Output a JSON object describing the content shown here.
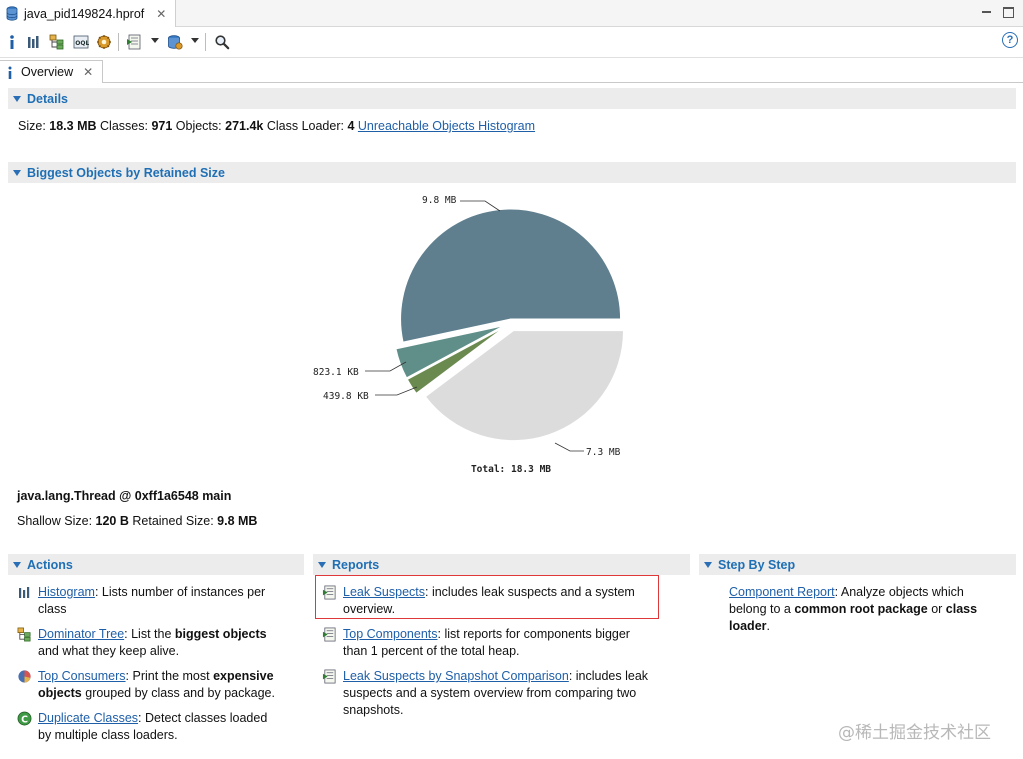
{
  "editor_tab": {
    "label": "java_pid149824.hprof"
  },
  "toolbar": {
    "items": [
      "info-icon",
      "histogram-icon",
      "dominator-tree-icon",
      "oql-icon",
      "top-consumers-icon",
      "run-report-icon",
      "heap-dump-overview-icon",
      "search-icon"
    ],
    "help": "?"
  },
  "view_tab": {
    "label": "Overview"
  },
  "details": {
    "header": "Details",
    "size_label": "Size:",
    "size_value": "18.3 MB",
    "classes_label": "Classes:",
    "classes_value": "971",
    "objects_label": "Objects:",
    "objects_value": "271.4k",
    "classloader_label": "Class Loader:",
    "classloader_value": "4",
    "link": "Unreachable Objects Histogram"
  },
  "biggest": {
    "header": "Biggest Objects by Retained Size",
    "selected_object": "java.lang.Thread @ 0xff1a6548 main",
    "shallow_label": "Shallow Size:",
    "shallow_value": "120 B",
    "retained_label": "Retained Size:",
    "retained_value": "9.8 MB"
  },
  "chart_data": {
    "type": "pie",
    "title": "",
    "total_label": "Total: 18.3 MB",
    "slices": [
      {
        "label": "9.8 MB",
        "value": 9.8,
        "unit": "MB",
        "color": "#5f7f8f"
      },
      {
        "label": "823.1 KB",
        "value": 0.8231,
        "unit": "MB",
        "color": "#5f8f88"
      },
      {
        "label": "439.8 KB",
        "value": 0.4398,
        "unit": "MB",
        "color": "#6b8a4f"
      },
      {
        "label": "7.3 MB",
        "value": 7.3,
        "unit": "MB",
        "color": "#dcdcdc"
      }
    ]
  },
  "actions": {
    "header": "Actions",
    "items": [
      {
        "icon": "histogram-icon",
        "link": "Histogram",
        "text_a": ": Lists number of instances per",
        "text_b": "class"
      },
      {
        "icon": "dominator-tree-icon",
        "link": "Dominator Tree",
        "text_a": ": List the ",
        "bold_a": "biggest objects",
        "text_b": "and what they keep alive."
      },
      {
        "icon": "top-consumers-icon",
        "link": "Top Consumers",
        "text_a": ": Print the most ",
        "bold_a": "expensive",
        "bold_b": "objects",
        "text_b": " grouped by class and by package."
      },
      {
        "icon": "duplicate-classes-icon",
        "link": "Duplicate Classes",
        "text_a": ": Detect classes loaded",
        "text_b": "by multiple class loaders."
      }
    ]
  },
  "reports": {
    "header": "Reports",
    "items": [
      {
        "icon": "report-icon",
        "link": "Leak Suspects",
        "text_a": ": includes leak suspects and a system",
        "text_b": "overview."
      },
      {
        "icon": "report-icon",
        "link": "Top Components",
        "text_a": ": list reports for components bigger",
        "text_b": "than 1 percent of the total heap."
      },
      {
        "icon": "report-icon",
        "link": "Leak Suspects by Snapshot Comparison",
        "text_a": ": includes leak",
        "text_b": "suspects and a system overview from comparing two",
        "text_c": "snapshots."
      }
    ]
  },
  "steps": {
    "header": "Step By Step",
    "link": "Component Report",
    "text_a": ": Analyze objects which",
    "text_b1": "belong to a ",
    "bold_b": "common root package",
    "text_b2": " or ",
    "bold_b2": "class",
    "bold_c": "loader",
    "text_c": "."
  },
  "watermark": "@稀土掘金技术社区"
}
